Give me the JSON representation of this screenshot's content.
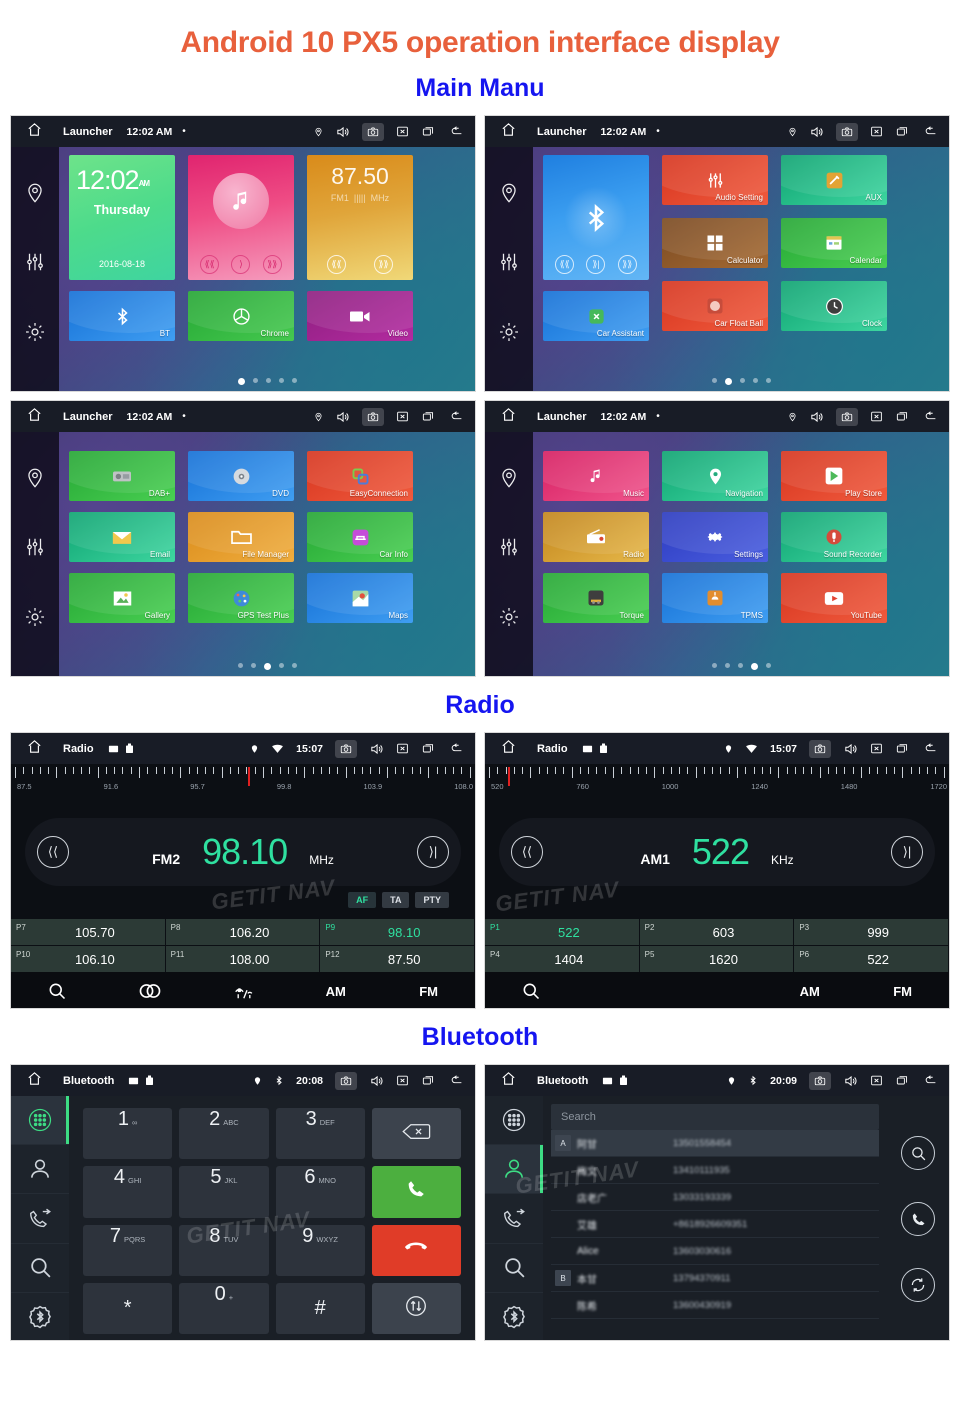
{
  "page": {
    "title": "Android 10 PX5 operation interface display",
    "sections": [
      {
        "heading": "Main Manu"
      },
      {
        "heading": "Radio"
      },
      {
        "heading": "Bluetooth"
      }
    ],
    "watermark": "GETIT NAV"
  },
  "launcher": {
    "statusbar": {
      "title": "Launcher",
      "time": "12:02 AM",
      "dot": "•"
    },
    "widgets": {
      "clock": {
        "time": "12:02",
        "meridiem": "AM",
        "day": "Thursday",
        "date": "2016-08-18"
      },
      "music": {
        "label": "music-widget"
      },
      "radio": {
        "freq": "87.50",
        "band": "FM1",
        "unit": "MHz"
      }
    },
    "pages": [
      {
        "index": 0,
        "dots": 5,
        "active_dot": 0,
        "tiles": [
          {
            "label": "BT",
            "icon": "bluetooth-icon",
            "color": "#1f7fe0"
          },
          {
            "label": "Chrome",
            "icon": "chrome-icon",
            "color": "#2fb83c"
          },
          {
            "label": "Video",
            "icon": "video-icon",
            "color": "#a0258f"
          }
        ]
      },
      {
        "index": 1,
        "dots": 5,
        "active_dot": 1,
        "big_tile": {
          "label": "bluetooth-player",
          "icon": "bluetooth-icon"
        },
        "tiles": [
          {
            "label": "Audio Setting",
            "icon": "equalizer-icon",
            "color": "#e8402a"
          },
          {
            "label": "AUX",
            "icon": "aux-icon",
            "color": "#14b87a"
          },
          {
            "label": "Calculator",
            "icon": "calculator-icon",
            "color": "#8a5a2b"
          },
          {
            "label": "Calendar",
            "icon": "calendar-icon",
            "color": "#2fb83c"
          },
          {
            "label": "Car Assistant",
            "icon": "car-assistant-icon",
            "color": "#1f7fe0"
          },
          {
            "label": "Car Float Ball",
            "icon": "float-ball-icon",
            "color": "#e8402a"
          },
          {
            "label": "Clock",
            "icon": "clock-icon",
            "color": "#14b87a"
          }
        ]
      },
      {
        "index": 2,
        "dots": 5,
        "active_dot": 2,
        "tiles": [
          {
            "label": "DAB+",
            "icon": "dab-radio-icon",
            "color": "#2fb83c"
          },
          {
            "label": "DVD",
            "icon": "dvd-disc-icon",
            "color": "#1f7fe0"
          },
          {
            "label": "EasyConnection",
            "icon": "easyconnection-icon",
            "color": "#e8402a"
          },
          {
            "label": "Email",
            "icon": "email-icon",
            "color": "#14b87a"
          },
          {
            "label": "File Manager",
            "icon": "folder-icon",
            "color": "#e8951a"
          },
          {
            "label": "Car Info",
            "icon": "car-info-icon",
            "color": "#2fb83c"
          },
          {
            "label": "Gallery",
            "icon": "gallery-icon",
            "color": "#2fb83c"
          },
          {
            "label": "GPS Test Plus",
            "icon": "gps-test-icon",
            "color": "#2fb83c"
          },
          {
            "label": "Maps",
            "icon": "maps-icon",
            "color": "#1f7fe0"
          }
        ]
      },
      {
        "index": 3,
        "dots": 5,
        "active_dot": 3,
        "tiles": [
          {
            "label": "Music",
            "icon": "music-note-icon",
            "color": "#e0246f"
          },
          {
            "label": "Navigation",
            "icon": "navigation-pin-icon",
            "color": "#14b87a"
          },
          {
            "label": "Play Store",
            "icon": "play-store-icon",
            "color": "#e8402a"
          },
          {
            "label": "Radio",
            "icon": "radio-icon",
            "color": "#d99a26"
          },
          {
            "label": "Settings",
            "icon": "gear-icon",
            "color": "#3b4ccf"
          },
          {
            "label": "Sound Recorder",
            "icon": "microphone-icon",
            "color": "#14b87a"
          },
          {
            "label": "Torque",
            "icon": "torque-icon",
            "color": "#2fb83c"
          },
          {
            "label": "TPMS",
            "icon": "tpms-icon",
            "color": "#1f7fe0"
          },
          {
            "label": "YouTube",
            "icon": "youtube-icon",
            "color": "#e8402a"
          }
        ]
      }
    ]
  },
  "radio": {
    "fm": {
      "statusbar": {
        "title": "Radio",
        "time": "15:07"
      },
      "scale_labels": [
        "87.5",
        "91.6",
        "95.7",
        "99.8",
        "103.9",
        "108.0"
      ],
      "needle_percent": 51,
      "band": "FM2",
      "frequency": "98.10",
      "unit": "MHz",
      "rds": [
        {
          "label": "AF",
          "active": true
        },
        {
          "label": "TA",
          "active": false
        },
        {
          "label": "PTY",
          "active": false
        }
      ],
      "presets": [
        {
          "name": "P7",
          "value": "105.70",
          "active": false
        },
        {
          "name": "P8",
          "value": "106.20",
          "active": false
        },
        {
          "name": "P9",
          "value": "98.10",
          "active": true
        },
        {
          "name": "P10",
          "value": "106.10",
          "active": false
        },
        {
          "name": "P11",
          "value": "108.00",
          "active": false
        },
        {
          "name": "P12",
          "value": "87.50",
          "active": false
        }
      ],
      "bottom": [
        {
          "label": "",
          "icon": "search-icon"
        },
        {
          "label": "",
          "icon": "stereo-icon"
        },
        {
          "label": "",
          "icon": "local-distant-icon"
        },
        {
          "label": "AM",
          "icon": ""
        },
        {
          "label": "FM",
          "icon": ""
        }
      ]
    },
    "am": {
      "statusbar": {
        "title": "Radio",
        "time": "15:07"
      },
      "scale_labels": [
        "520",
        "760",
        "1000",
        "1240",
        "1480",
        "1720"
      ],
      "needle_percent": 5,
      "band": "AM1",
      "frequency": "522",
      "unit": "KHz",
      "presets": [
        {
          "name": "P1",
          "value": "522",
          "active": true
        },
        {
          "name": "P2",
          "value": "603",
          "active": false
        },
        {
          "name": "P3",
          "value": "999",
          "active": false
        },
        {
          "name": "P4",
          "value": "1404",
          "active": false
        },
        {
          "name": "P5",
          "value": "1620",
          "active": false
        },
        {
          "name": "P6",
          "value": "522",
          "active": false
        }
      ],
      "bottom": [
        {
          "label": "",
          "icon": "search-icon"
        },
        {
          "label": "",
          "icon": ""
        },
        {
          "label": "",
          "icon": ""
        },
        {
          "label": "AM",
          "icon": ""
        },
        {
          "label": "FM",
          "icon": ""
        }
      ]
    }
  },
  "bluetooth": {
    "dialpad_screen": {
      "statusbar": {
        "title": "Bluetooth",
        "time": "20:08"
      },
      "rail": [
        {
          "icon": "dialpad-icon",
          "active": true
        },
        {
          "icon": "contacts-icon",
          "active": false
        },
        {
          "icon": "call-history-icon",
          "active": false
        },
        {
          "icon": "search-icon",
          "active": false
        },
        {
          "icon": "bluetooth-settings-icon",
          "active": false
        }
      ],
      "keys": [
        {
          "num": "1",
          "sub": "∞"
        },
        {
          "num": "2",
          "sub": "ABC"
        },
        {
          "num": "3",
          "sub": "DEF"
        },
        {
          "num": "",
          "sub": "",
          "icon": "backspace-icon",
          "type": "act"
        },
        {
          "num": "4",
          "sub": "GHI"
        },
        {
          "num": "5",
          "sub": "JKL"
        },
        {
          "num": "6",
          "sub": "MNO"
        },
        {
          "num": "",
          "sub": "",
          "icon": "call-icon",
          "type": "green"
        },
        {
          "num": "7",
          "sub": "PQRS"
        },
        {
          "num": "8",
          "sub": "TUV"
        },
        {
          "num": "9",
          "sub": "WXYZ"
        },
        {
          "num": "",
          "sub": "",
          "icon": "hangup-icon",
          "type": "red"
        },
        {
          "num": "*",
          "sub": "",
          "type": "sym"
        },
        {
          "num": "0",
          "sub": "+"
        },
        {
          "num": "#",
          "sub": "",
          "type": "sym"
        },
        {
          "num": "",
          "sub": "",
          "icon": "transfer-icon",
          "type": "act"
        }
      ]
    },
    "contacts_screen": {
      "statusbar": {
        "title": "Bluetooth",
        "time": "20:09"
      },
      "rail": [
        {
          "icon": "dialpad-icon",
          "active": false
        },
        {
          "icon": "contacts-icon",
          "active": true
        },
        {
          "icon": "call-history-icon",
          "active": false
        },
        {
          "icon": "search-icon",
          "active": false
        },
        {
          "icon": "bluetooth-settings-icon",
          "active": false
        }
      ],
      "search_placeholder": "Search",
      "contacts": [
        {
          "badge": "A",
          "name": "阿甘",
          "number": "13501558454",
          "selected": true
        },
        {
          "badge": "",
          "name": "梅文",
          "number": "13410111935",
          "selected": false
        },
        {
          "badge": "",
          "name": "店老广",
          "number": "13033193339",
          "selected": false
        },
        {
          "badge": "",
          "name": "艾雄",
          "number": "+8618926609351",
          "selected": false
        },
        {
          "badge": "",
          "name": "Alice",
          "number": "13603030616",
          "selected": false
        },
        {
          "badge": "B",
          "name": "本甘",
          "number": "13794370911",
          "selected": false
        },
        {
          "badge": "",
          "name": "陈希",
          "number": "13600430919",
          "selected": false
        }
      ],
      "actions": [
        {
          "icon": "search-icon"
        },
        {
          "icon": "call-icon"
        },
        {
          "icon": "sync-icon"
        }
      ]
    }
  }
}
